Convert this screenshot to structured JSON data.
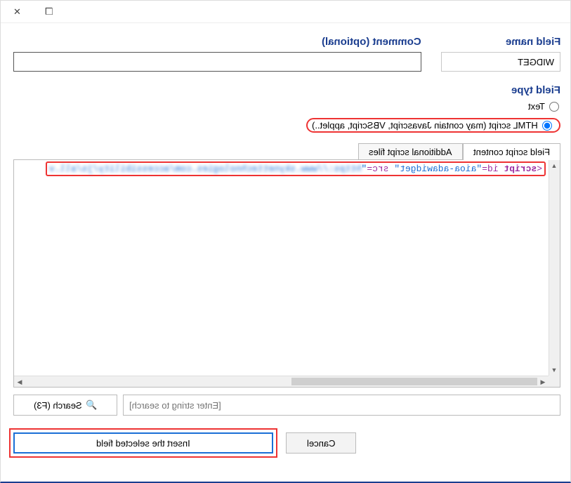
{
  "labels": {
    "field_name": "Field name",
    "comment": "Comment (optional)",
    "field_type": "Field type"
  },
  "fields": {
    "name_value": "WIDGET",
    "comment_value": ""
  },
  "radios": {
    "text": "Text",
    "html": "HTML script (may contain Javascript, VBScript, applet..)"
  },
  "tabs": {
    "script_content": "Field script content",
    "additional_files": "Additional script files"
  },
  "code": {
    "open_tag": "<",
    "tag": "script",
    "sp1": " ",
    "id_attr": "id=",
    "id_val": "\"aioa-adawidget\"",
    "sp2": " ",
    "src_attr": "src=",
    "src_q": "\"",
    "src_blur": "https://www.skynettechnologies.com/accessibility/js/all.v"
  },
  "search": {
    "placeholder": "[Enter string to search]",
    "label": "Search (F3)"
  },
  "buttons": {
    "insert": "Insert the selected field",
    "cancel": "Cancel"
  },
  "icons": {
    "close": "✕",
    "restore": "❐",
    "search": "🔍"
  }
}
